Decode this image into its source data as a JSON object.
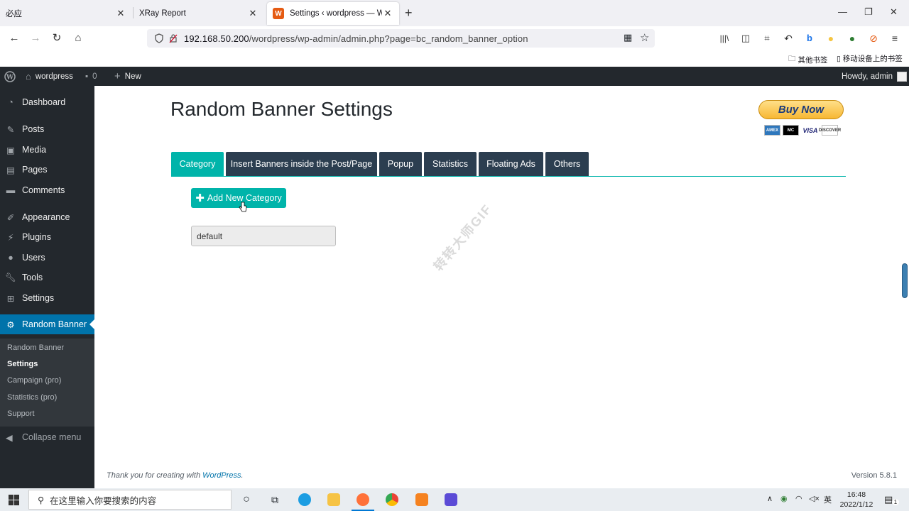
{
  "browser": {
    "tabs": [
      {
        "label": "必应",
        "active": false
      },
      {
        "label": "XRay Report",
        "active": false
      },
      {
        "label": "Settings ‹ wordpress — Word",
        "active": true
      }
    ],
    "url_host": "192.168.50.200",
    "url_path": "/wordpress/wp-admin/admin.php?page=bc_random_banner_option",
    "bookmarks": [
      "其他书签",
      "移动设备上的书签"
    ]
  },
  "adminbar": {
    "site_name": "wordpress",
    "comments_count": "0",
    "new_label": "New",
    "greeting": "Howdy, admin"
  },
  "menu": {
    "items": [
      {
        "label": "Dashboard",
        "icon": "dashboard-icon"
      },
      {
        "label": "Posts",
        "icon": "pin-icon"
      },
      {
        "label": "Media",
        "icon": "media-icon"
      },
      {
        "label": "Pages",
        "icon": "pages-icon"
      },
      {
        "label": "Comments",
        "icon": "comments-icon"
      },
      {
        "label": "Appearance",
        "icon": "brush-icon"
      },
      {
        "label": "Plugins",
        "icon": "plugin-icon"
      },
      {
        "label": "Users",
        "icon": "user-icon"
      },
      {
        "label": "Tools",
        "icon": "wrench-icon"
      },
      {
        "label": "Settings",
        "icon": "settings-icon"
      },
      {
        "label": "Random Banner",
        "icon": "gear-icon"
      }
    ],
    "submenu": [
      "Random Banner",
      "Settings",
      "Campaign (pro)",
      "Statistics (pro)",
      "Support"
    ],
    "collapse_label": "Collapse menu"
  },
  "page": {
    "title": "Random Banner Settings",
    "buy_now": "Buy Now",
    "cards": [
      "AMEX",
      "MC",
      "VISA",
      "DISCOVER"
    ],
    "tabs": [
      "Category",
      "Insert Banners inside the Post/Page",
      "Popup",
      "Statistics",
      "Floating Ads",
      "Others"
    ],
    "add_button": "Add New Category",
    "category_value": "default",
    "watermark": "转转大师GIF"
  },
  "footer": {
    "thanks": "Thank you for creating with ",
    "wp_link": "WordPress",
    "dot": ".",
    "version": "Version 5.8.1"
  },
  "taskbar": {
    "search_placeholder": "在这里输入你要搜索的内容",
    "ime": "英",
    "time": "16:48",
    "date": "2022/1/12",
    "notification_count": "1"
  },
  "colors": {
    "accent": "#00b4aa",
    "wp_dark": "#23282d",
    "wp_blue": "#0073aa",
    "tab_dark": "#2c3e50"
  }
}
